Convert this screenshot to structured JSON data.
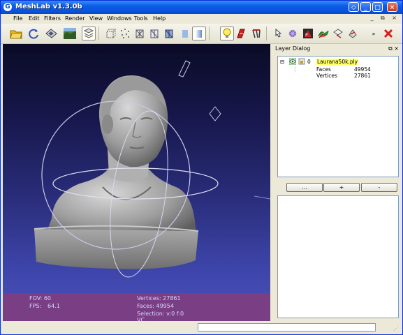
{
  "window": {
    "title": "MeshLab v1.3.0b",
    "app_icon_glyph": "G",
    "controls": [
      "restore",
      "minimize",
      "maximize",
      "close"
    ]
  },
  "menubar": {
    "items": [
      "File",
      "Edit",
      "Filters",
      "Render",
      "View",
      "Windows",
      "Tools",
      "Help"
    ],
    "mdi_controls": "_ ⧉ ×"
  },
  "toolbar": {
    "overflow_glyph": "»",
    "icons": [
      "open-folder-icon",
      "reload-icon",
      "save-snapshot-icon",
      "snapshot-icon",
      "layers-icon",
      "bbox-icon",
      "points-icon",
      "wireframe-icon",
      "hidden-lines-icon",
      "flat-lines-icon",
      "flat-icon",
      "smooth-icon",
      "light-icon",
      "texture-icon",
      "color-icon",
      "select-icon",
      "paint-icon",
      "measure-icon",
      "align-icon",
      "move-icon",
      "delete-icon"
    ]
  },
  "viewport": {
    "overlay": {
      "fov_label": "FOV: 60",
      "fps_label": "FPS:",
      "fps_value": "64.1",
      "vertices": "Vertices: 27861",
      "faces": "Faces: 49954",
      "selection": "Selection: v:0 f:0",
      "vc": "VC"
    }
  },
  "layer_dialog": {
    "title": "Layer Dialog",
    "title_buttons": "⧉ ×",
    "layer": {
      "expander": "⊟",
      "index": "0",
      "name": "Laurana50k.ply",
      "rows": [
        {
          "label": "Faces",
          "value": "49954"
        },
        {
          "label": "Vertices",
          "value": "27861"
        }
      ]
    },
    "buttons": {
      "more": "...",
      "add": "+",
      "remove": "-"
    }
  },
  "colors": {
    "titlebar": "#0a5ce8",
    "overlay_bg": "#7a3e84",
    "layer_highlight": "#ffff66",
    "viewport_top": "#0b0b26",
    "viewport_bottom": "#4a52bd"
  }
}
